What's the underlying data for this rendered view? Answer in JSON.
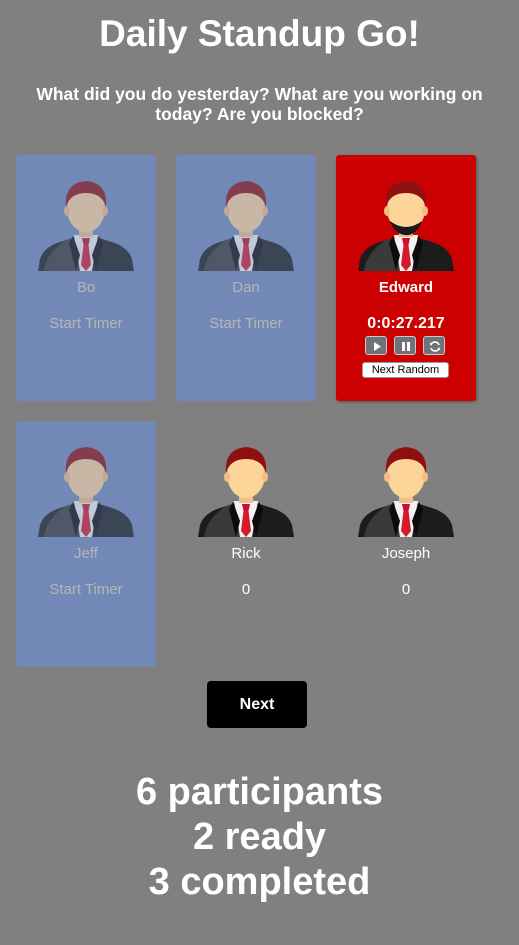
{
  "header": {
    "title": "Daily Standup Go!",
    "subtitle": "What did you do yesterday? What are you working on today? Are you blocked?"
  },
  "participants": [
    {
      "name": "Bo",
      "status": "completed",
      "action_label": "Start Timer"
    },
    {
      "name": "Dan",
      "status": "completed",
      "action_label": "Start Timer"
    },
    {
      "name": "Edward",
      "status": "speaking",
      "timer": "0:0:27.217",
      "next_random_label": "Next Random"
    },
    {
      "name": "Jeff",
      "status": "completed",
      "action_label": "Start Timer"
    },
    {
      "name": "Rick",
      "status": "ready",
      "count": "0"
    },
    {
      "name": "Joseph",
      "status": "ready",
      "count": "0"
    }
  ],
  "icons": {
    "avatar": "businessman-avatar-icon",
    "play": "play-icon",
    "pause": "pause-icon",
    "reset": "refresh-icon"
  },
  "next_button_label": "Next",
  "summary": {
    "participants": "6 participants",
    "ready": "2 ready",
    "completed": "3 completed"
  },
  "colors": {
    "background": "#808080",
    "completed_card": "#7289b7",
    "active_card": "#cc0000",
    "next_button": "#000000"
  }
}
